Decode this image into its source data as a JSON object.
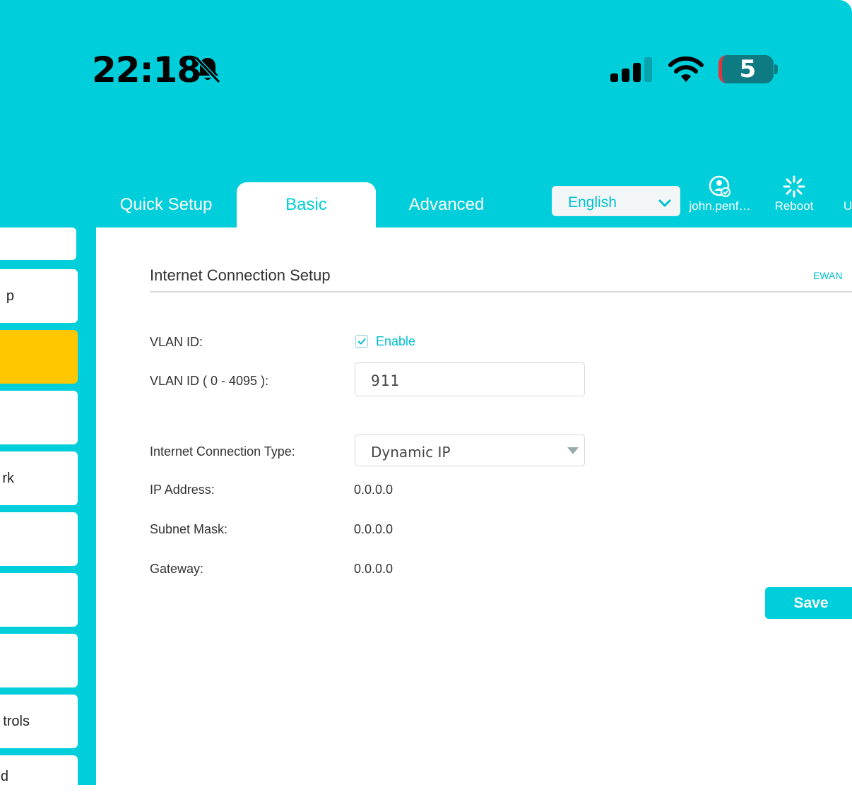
{
  "status_bar": {
    "time": "22:18",
    "battery_level": "5",
    "icons": [
      "bell-slash-icon",
      "cellular-signal-icon",
      "wifi-icon",
      "battery-icon"
    ]
  },
  "nav": {
    "tabs": [
      {
        "label": "Quick Setup",
        "active": false
      },
      {
        "label": "Basic",
        "active": true
      },
      {
        "label": "Advanced",
        "active": false
      }
    ],
    "language": "English",
    "user_label": "john.penf…",
    "reboot_label": "Reboot",
    "more_label": "U"
  },
  "sidebar": {
    "items": [
      {
        "label": "p",
        "active": false
      },
      {
        "label": "",
        "active": true
      },
      {
        "label": "",
        "active": false
      },
      {
        "label": "rk",
        "active": false
      },
      {
        "label": "",
        "active": false
      },
      {
        "label": "",
        "active": false
      },
      {
        "label": "",
        "active": false
      },
      {
        "label": "trols",
        "active": false
      },
      {
        "label": "d",
        "active": false
      }
    ]
  },
  "section": {
    "title": "Internet Connection Setup",
    "link": "EWAN"
  },
  "form": {
    "vlan_label": "VLAN ID:",
    "vlan_enable_label": "Enable",
    "vlan_enabled": true,
    "vlan_id_label": "VLAN ID ( 0 - 4095 ):",
    "vlan_id_value": "911",
    "conn_type_label": "Internet Connection Type:",
    "conn_type_value": "Dynamic IP",
    "ip_label": "IP Address:",
    "ip_value": "0.0.0.0",
    "subnet_label": "Subnet Mask:",
    "subnet_value": "0.0.0.0",
    "gateway_label": "Gateway:",
    "gateway_value": "0.0.0.0",
    "save_label": "Save"
  },
  "colors": {
    "accent": "#00cedb",
    "active_sidebar": "#ffc700",
    "battery_low": "#e5323b"
  }
}
